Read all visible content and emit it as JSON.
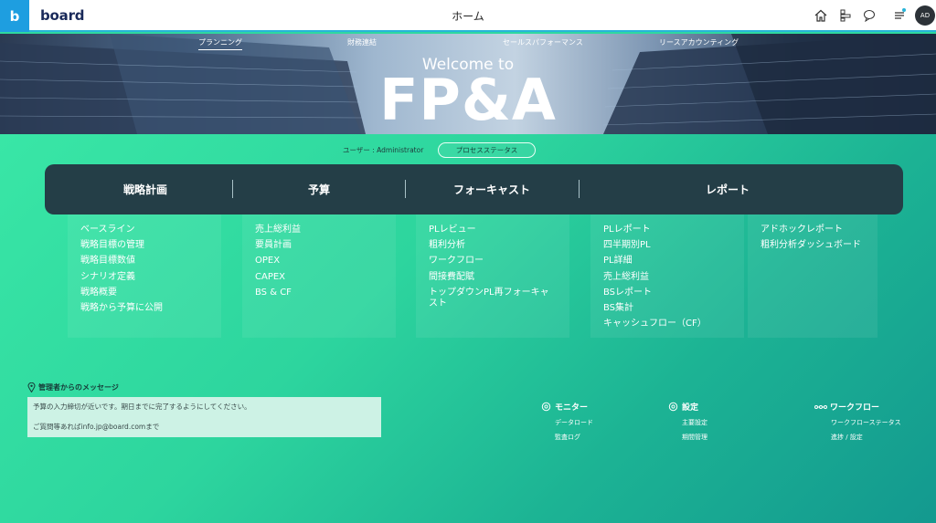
{
  "app": {
    "logo_letter": "b",
    "logo_text": "board"
  },
  "header": {
    "title": "ホーム",
    "avatar_initials": "AD"
  },
  "hero": {
    "nav": [
      {
        "label": "プランニング",
        "active": true
      },
      {
        "label": "財務連結",
        "active": false
      },
      {
        "label": "セールスパフォーマンス",
        "active": false
      },
      {
        "label": "リースアカウンティング",
        "active": false
      }
    ],
    "welcome": "Welcome to",
    "title": "FP&A"
  },
  "user": {
    "label": "ユーザー : Administrator",
    "process_status_button": "プロセスステータス"
  },
  "menu": {
    "tabs": [
      "戦略計画",
      "予算",
      "フォーキャスト",
      "レポート"
    ]
  },
  "columns": [
    {
      "items": [
        "ベースライン",
        "戦略目標の管理",
        "戦略目標数値",
        "シナリオ定義",
        "戦略概要",
        "戦略から予算に公開"
      ]
    },
    {
      "items": [
        "売上総利益",
        "要員計画",
        "OPEX",
        "CAPEX",
        "BS & CF"
      ]
    },
    {
      "items": [
        "PLレビュー",
        "粗利分析",
        "ワークフロー",
        "間接費配賦",
        "トップダウンPL再フォーキャスト"
      ]
    },
    {
      "items": [
        "PLレポート",
        "四半期別PL",
        "PL詳細",
        "売上総利益",
        "BSレポート",
        "BS集計",
        "キャッシュフロー（CF）"
      ]
    },
    {
      "items": [
        "アドホックレポート",
        "粗利分析ダッシュボード"
      ]
    }
  ],
  "message": {
    "heading": "管理者からのメッセージ",
    "line1": "予算の入力締切が近いです。期日までに完了するようにしてください。",
    "line2": "ご質問等あればinfo.jp@board.comまで"
  },
  "footer": {
    "monitor": {
      "title": "モニター",
      "items": [
        "データロード",
        "監査ログ"
      ]
    },
    "settings": {
      "title": "設定",
      "items": [
        "主要設定",
        "期間管理"
      ]
    },
    "workflow": {
      "title": "ワークフロー",
      "items": [
        "ワークフローステータス",
        "進捗 / 設定"
      ]
    }
  },
  "icons": [
    "home-icon",
    "process-icon",
    "chat-icon",
    "notifications-icon",
    "pin-icon",
    "gear-icon",
    "workflow-icon"
  ],
  "colors": {
    "accent": "#1e9ee0",
    "menu_bar": "#243e47",
    "background_start": "#39e6a6",
    "background_end": "#13998f"
  }
}
